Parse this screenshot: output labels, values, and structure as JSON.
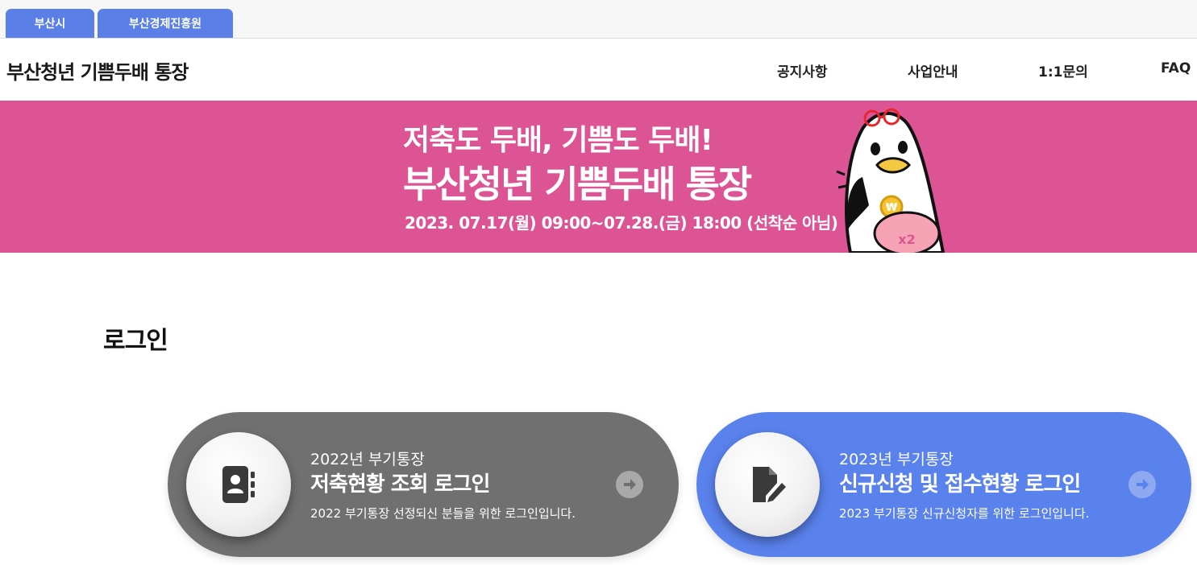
{
  "top_tabs": [
    {
      "label": "부산시"
    },
    {
      "label": "부산경제진흥원"
    }
  ],
  "header": {
    "site_title": "부산청년 기쁨두배 통장",
    "nav": [
      {
        "label": "공지사항"
      },
      {
        "label": "사업안내"
      },
      {
        "label": "1:1문의"
      },
      {
        "label": "FAQ"
      }
    ]
  },
  "banner": {
    "line1": "저축도 두배, 기쁨도 두배!",
    "line2": "부산청년 기쁨두배 통장",
    "line3": "2023. 07.17(월) 09:00~07.28.(금) 18:00 (선착순 아님)",
    "mascot_coin": "₩",
    "mascot_pig_text": "x2",
    "background_color": "#dd5494"
  },
  "login": {
    "title": "로그인",
    "cards": [
      {
        "year": "2022년 부기통장",
        "heading": "저축현황 조회 로그인",
        "description": "2022 부기통장 선정되신 분들을 위한 로그인입니다.",
        "icon": "address-book-icon",
        "color": "#707070"
      },
      {
        "year": "2023년 부기통장",
        "heading": "신규신청 및 접수현황 로그인",
        "description": "2023 부기통장 신규신청자를 위한 로그인입니다.",
        "icon": "file-signature-icon",
        "color": "#5a82ec"
      }
    ]
  },
  "colors": {
    "accent_blue": "#5a7fe6",
    "banner_pink": "#dd5494"
  }
}
